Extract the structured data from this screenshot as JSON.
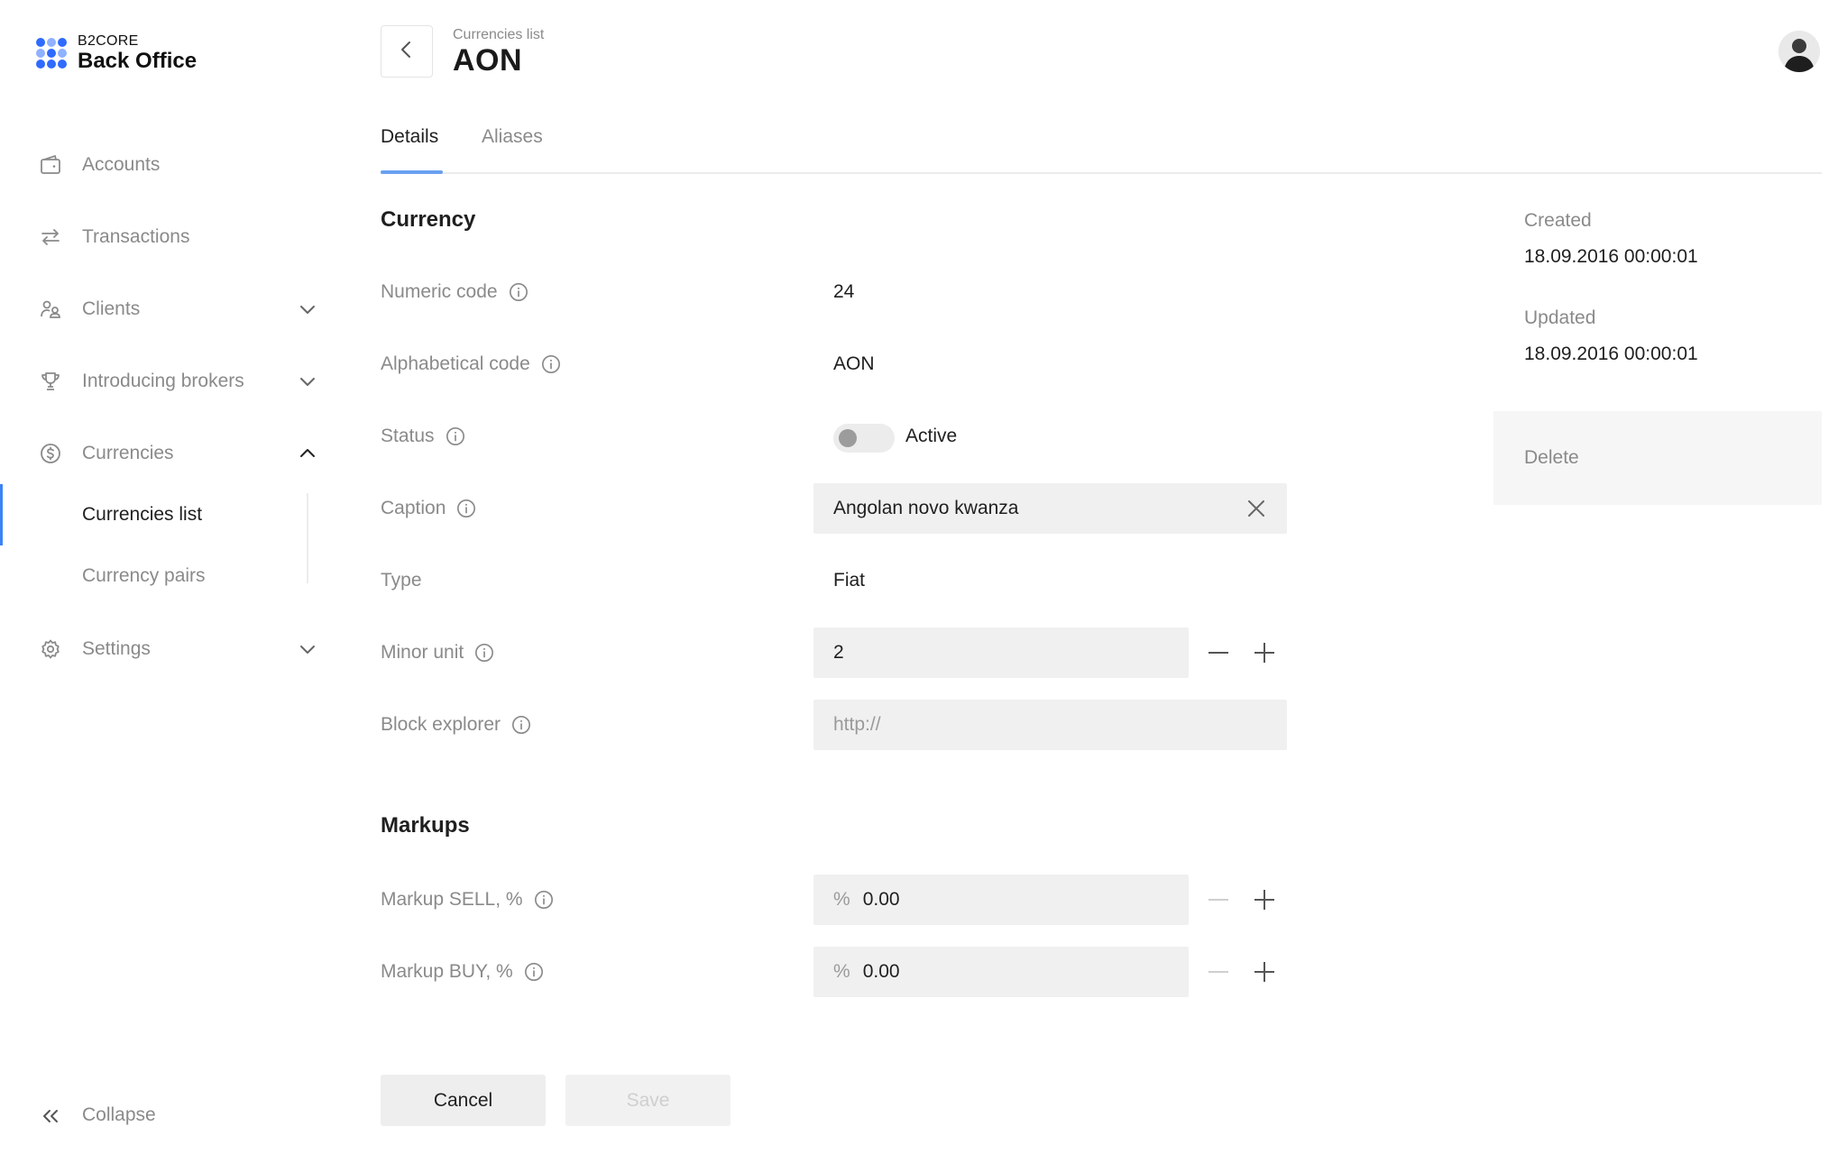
{
  "brand": {
    "small": "B2CORE",
    "name": "Back Office",
    "color_primary": "#2f6bff",
    "color_light": "#8fb1ff"
  },
  "sidebar": {
    "items": [
      {
        "label": "Accounts",
        "icon": "wallet-icon"
      },
      {
        "label": "Transactions",
        "icon": "arrows-exchange-icon"
      },
      {
        "label": "Clients",
        "icon": "users-icon",
        "expandable": true
      },
      {
        "label": "Introducing brokers",
        "icon": "trophy-icon",
        "expandable": true
      },
      {
        "label": "Currencies",
        "icon": "dollar-circle-icon",
        "expanded": true
      },
      {
        "label": "Settings",
        "icon": "gear-icon",
        "expandable": true
      }
    ],
    "currencies_sub": [
      {
        "label": "Currencies list",
        "active": true
      },
      {
        "label": "Currency pairs",
        "active": false
      }
    ],
    "collapse_label": "Collapse",
    "active_color": "#3b82f6"
  },
  "header": {
    "breadcrumb": "Currencies list",
    "title": "AON"
  },
  "tabs": [
    {
      "label": "Details",
      "active": true
    },
    {
      "label": "Aliases",
      "active": false
    }
  ],
  "currency_section": {
    "title": "Currency",
    "numeric_code": {
      "label": "Numeric code",
      "value": "24"
    },
    "alphabetical_code": {
      "label": "Alphabetical code",
      "value": "AON"
    },
    "status": {
      "label": "Status",
      "value": "Active",
      "enabled": false
    },
    "caption": {
      "label": "Caption",
      "value": "Angolan novo kwanza"
    },
    "type": {
      "label": "Type",
      "value": "Fiat"
    },
    "minor_unit": {
      "label": "Minor unit",
      "value": "2"
    },
    "block_explorer": {
      "label": "Block explorer",
      "placeholder": "http://"
    }
  },
  "markups_section": {
    "title": "Markups",
    "sell": {
      "label": "Markup SELL, %",
      "prefix": "%",
      "value": "0.00"
    },
    "buy": {
      "label": "Markup BUY, %",
      "prefix": "%",
      "value": "0.00"
    }
  },
  "meta": {
    "created_label": "Created",
    "created_value": "18.09.2016 00:00:01",
    "updated_label": "Updated",
    "updated_value": "18.09.2016 00:00:01",
    "delete_label": "Delete"
  },
  "actions": {
    "cancel": "Cancel",
    "save": "Save"
  }
}
